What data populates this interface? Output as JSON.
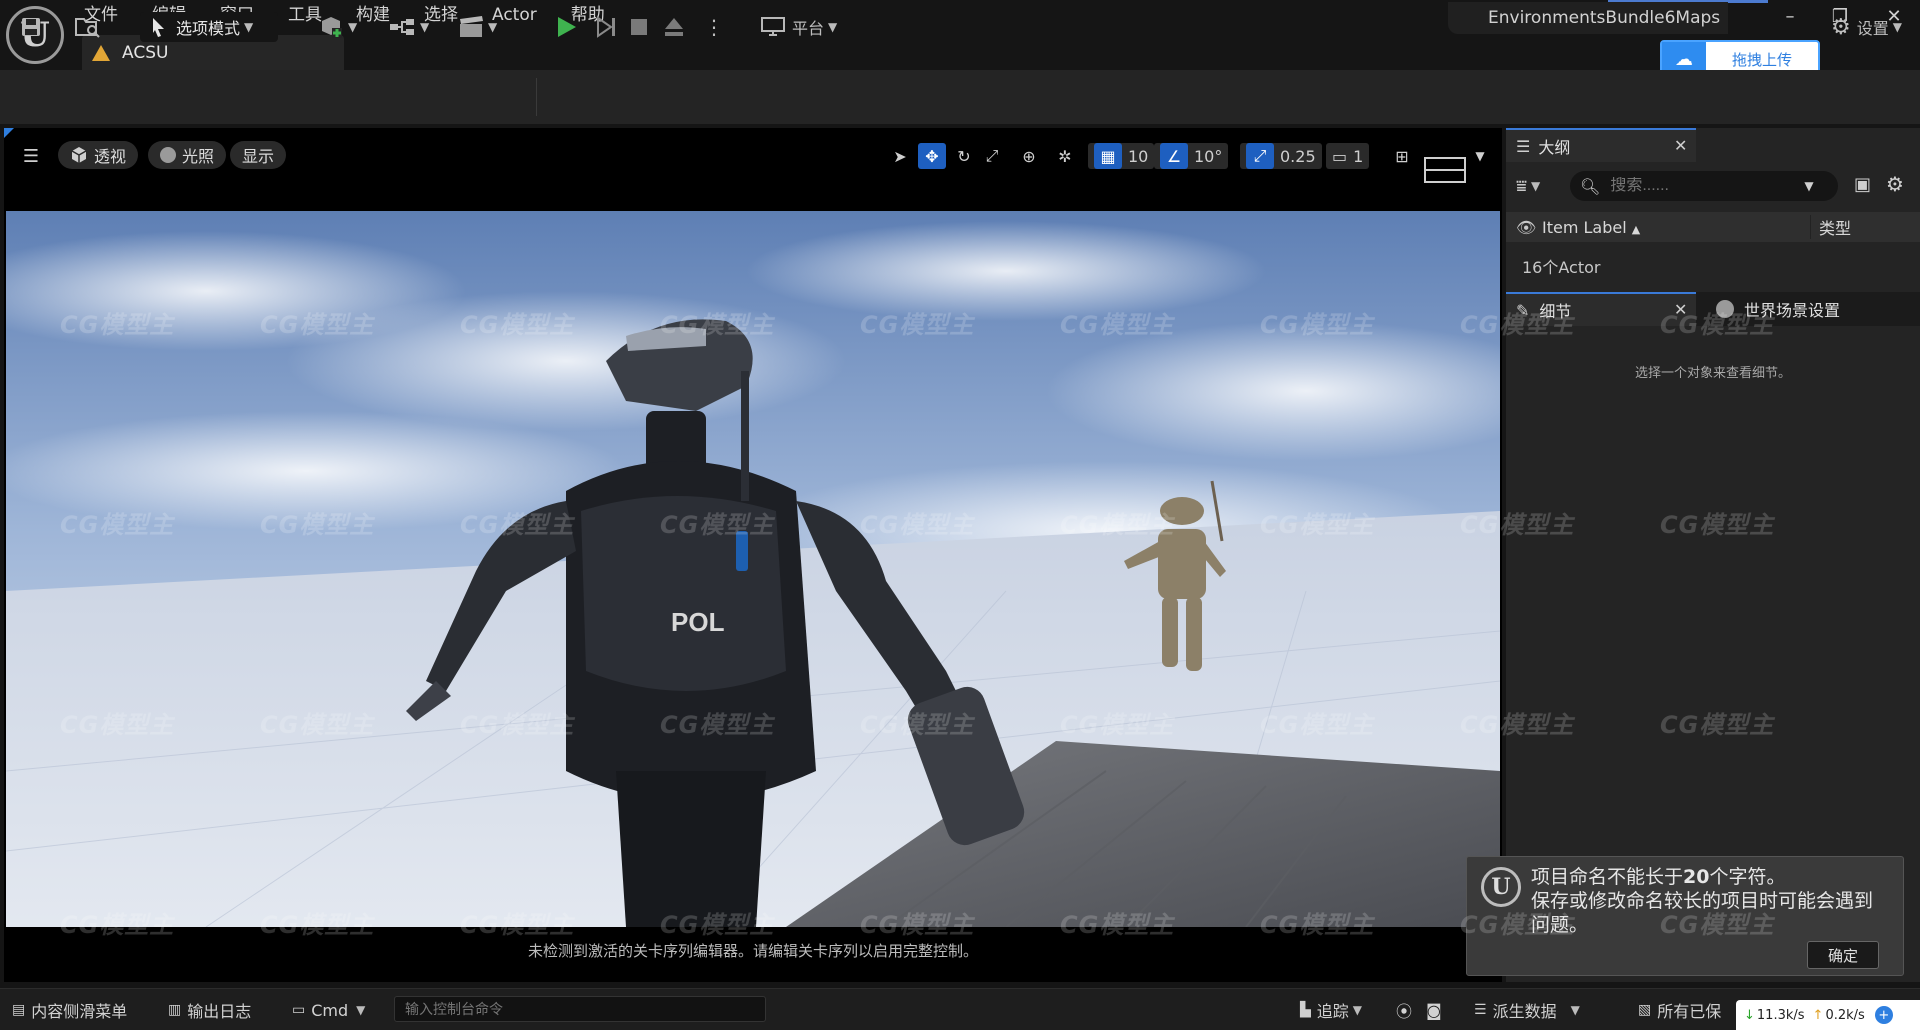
{
  "app": {
    "logo_letter": "U",
    "menu": [
      "文件",
      "编辑",
      "窗口",
      "工具",
      "构建",
      "选择",
      "Actor",
      "帮助"
    ],
    "level_tab": "ACSU",
    "project_name": "EnvironmentsBundle6Maps",
    "window_controls": [
      "–",
      "❐",
      "✕"
    ]
  },
  "upload": {
    "label": "拖拽上传"
  },
  "toolbar": {
    "mode_label": "选项模式",
    "platform_label": "平台",
    "settings_label": "设置"
  },
  "viewport": {
    "view_mode": "透视",
    "lighting": "光照",
    "show": "显示",
    "grid_snap": "10",
    "rotate_snap": "10°",
    "scale_snap": "0.25",
    "camera_speed": "1",
    "sequencer_message": "未检测到激活的关卡序列编辑器。请编辑关卡序列以启用完整控制。"
  },
  "outliner": {
    "tab_label": "大纲",
    "search_placeholder": "搜索......",
    "col_label": "Item Label",
    "col_type": "类型",
    "actor_count": "16个Actor"
  },
  "details": {
    "tab_label": "细节",
    "world_tab_label": "世界场景设置",
    "empty_message": "选择一个对象来查看细节。"
  },
  "notification": {
    "logo_letter": "U",
    "line1_pre": "项目命名不能长于",
    "line1_num": "20",
    "line1_post": "个字符。",
    "line2": "保存或修改命名较长的项目时可能会遇到问题。",
    "ok_label": "确定"
  },
  "statusbar": {
    "content_drawer": "内容侧滑菜单",
    "output_log": "输出日志",
    "cmd": "Cmd",
    "console_placeholder": "输入控制台命令",
    "trace": "追踪",
    "derived_data": "派生数据",
    "save_all": "所有已保",
    "download_speed": "11.3k/s",
    "upload_speed": "0.2k/s"
  },
  "watermark": "CG模型主",
  "colors": {
    "accent": "#2f7fe0",
    "play_green": "#3fb34f",
    "warning": "#e2a636"
  }
}
